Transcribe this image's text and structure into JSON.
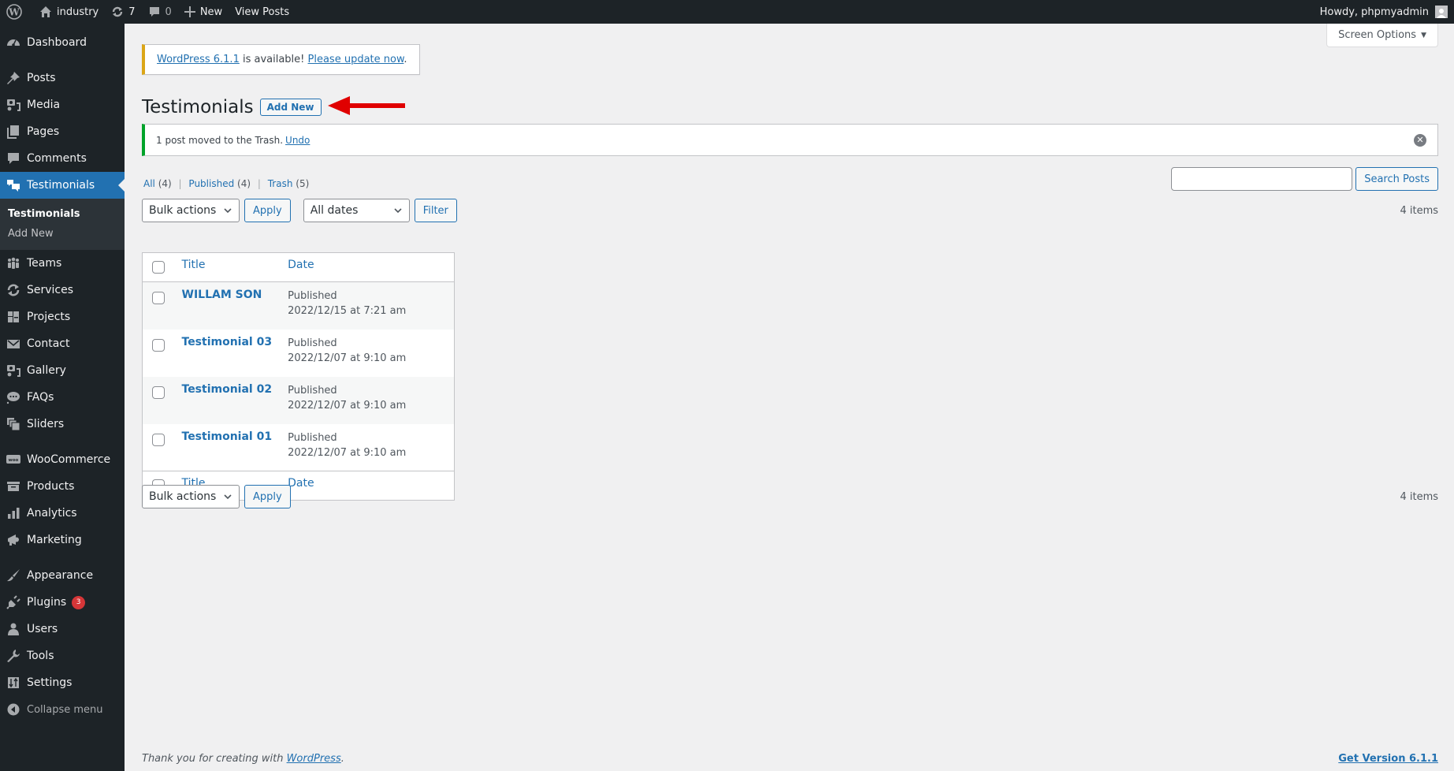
{
  "admin_bar": {
    "site_name": "industry",
    "updates_count": "7",
    "comments_count": "0",
    "new_label": "New",
    "view_posts_label": "View Posts",
    "howdy": "Howdy, phpmyadmin"
  },
  "sidebar": {
    "items": [
      {
        "label": "Dashboard",
        "icon": "dashboard-icon"
      },
      {
        "label": "Posts",
        "icon": "pin-icon"
      },
      {
        "label": "Media",
        "icon": "media-icon"
      },
      {
        "label": "Pages",
        "icon": "pages-icon"
      },
      {
        "label": "Comments",
        "icon": "comment-icon"
      },
      {
        "label": "Testimonials",
        "icon": "testimonial-icon",
        "active": true
      },
      {
        "label": "Teams",
        "icon": "groups-icon"
      },
      {
        "label": "Services",
        "icon": "update-icon"
      },
      {
        "label": "Projects",
        "icon": "layout-icon"
      },
      {
        "label": "Contact",
        "icon": "email-icon"
      },
      {
        "label": "Gallery",
        "icon": "media-icon"
      },
      {
        "label": "FAQs",
        "icon": "format-chat-icon"
      },
      {
        "label": "Sliders",
        "icon": "slides-icon"
      },
      {
        "label": "WooCommerce",
        "icon": "woo-icon"
      },
      {
        "label": "Products",
        "icon": "archive-icon"
      },
      {
        "label": "Analytics",
        "icon": "chart-bar-icon"
      },
      {
        "label": "Marketing",
        "icon": "megaphone-icon"
      },
      {
        "label": "Appearance",
        "icon": "brush-icon"
      },
      {
        "label": "Plugins",
        "icon": "plugin-icon",
        "badge": "3"
      },
      {
        "label": "Users",
        "icon": "user-icon"
      },
      {
        "label": "Tools",
        "icon": "wrench-icon"
      },
      {
        "label": "Settings",
        "icon": "settings-icon"
      }
    ],
    "submenu": {
      "current": "Testimonials",
      "add_new": "Add New"
    },
    "collapse_label": "Collapse menu"
  },
  "screen_options": "Screen Options",
  "update_nag": {
    "version_link": "WordPress 6.1.1",
    "text": " is available! ",
    "update_link": "Please update now",
    "period": "."
  },
  "page": {
    "title": "Testimonials",
    "add_new": "Add New"
  },
  "notice": {
    "message": "1 post moved to the Trash.",
    "undo": "Undo"
  },
  "views": {
    "all_label": "All",
    "all_count": "(4)",
    "published_label": "Published",
    "published_count": "(4)",
    "trash_label": "Trash",
    "trash_count": "(5)"
  },
  "search": {
    "value": "",
    "button": "Search Posts"
  },
  "tablenav": {
    "bulk_actions": "Bulk actions",
    "apply": "Apply",
    "all_dates": "All dates",
    "filter": "Filter",
    "items_count": "4 items"
  },
  "table": {
    "columns": {
      "title": "Title",
      "date": "Date"
    },
    "rows": [
      {
        "title": "WILLAM SON",
        "status": "Published",
        "date": "2022/12/15 at 7:21 am"
      },
      {
        "title": "Testimonial 03",
        "status": "Published",
        "date": "2022/12/07 at 9:10 am"
      },
      {
        "title": "Testimonial 02",
        "status": "Published",
        "date": "2022/12/07 at 9:10 am"
      },
      {
        "title": "Testimonial 01",
        "status": "Published",
        "date": "2022/12/07 at 9:10 am"
      }
    ]
  },
  "footer": {
    "thanks": "Thank you for creating with ",
    "wp_link": "WordPress",
    "period": ".",
    "version": "Get Version 6.1.1"
  },
  "colors": {
    "accent": "#2271b1",
    "admin_bg": "#1d2327",
    "success": "#00a32a",
    "warning": "#dba617",
    "badge": "#d63638",
    "arrow": "#e00000"
  }
}
